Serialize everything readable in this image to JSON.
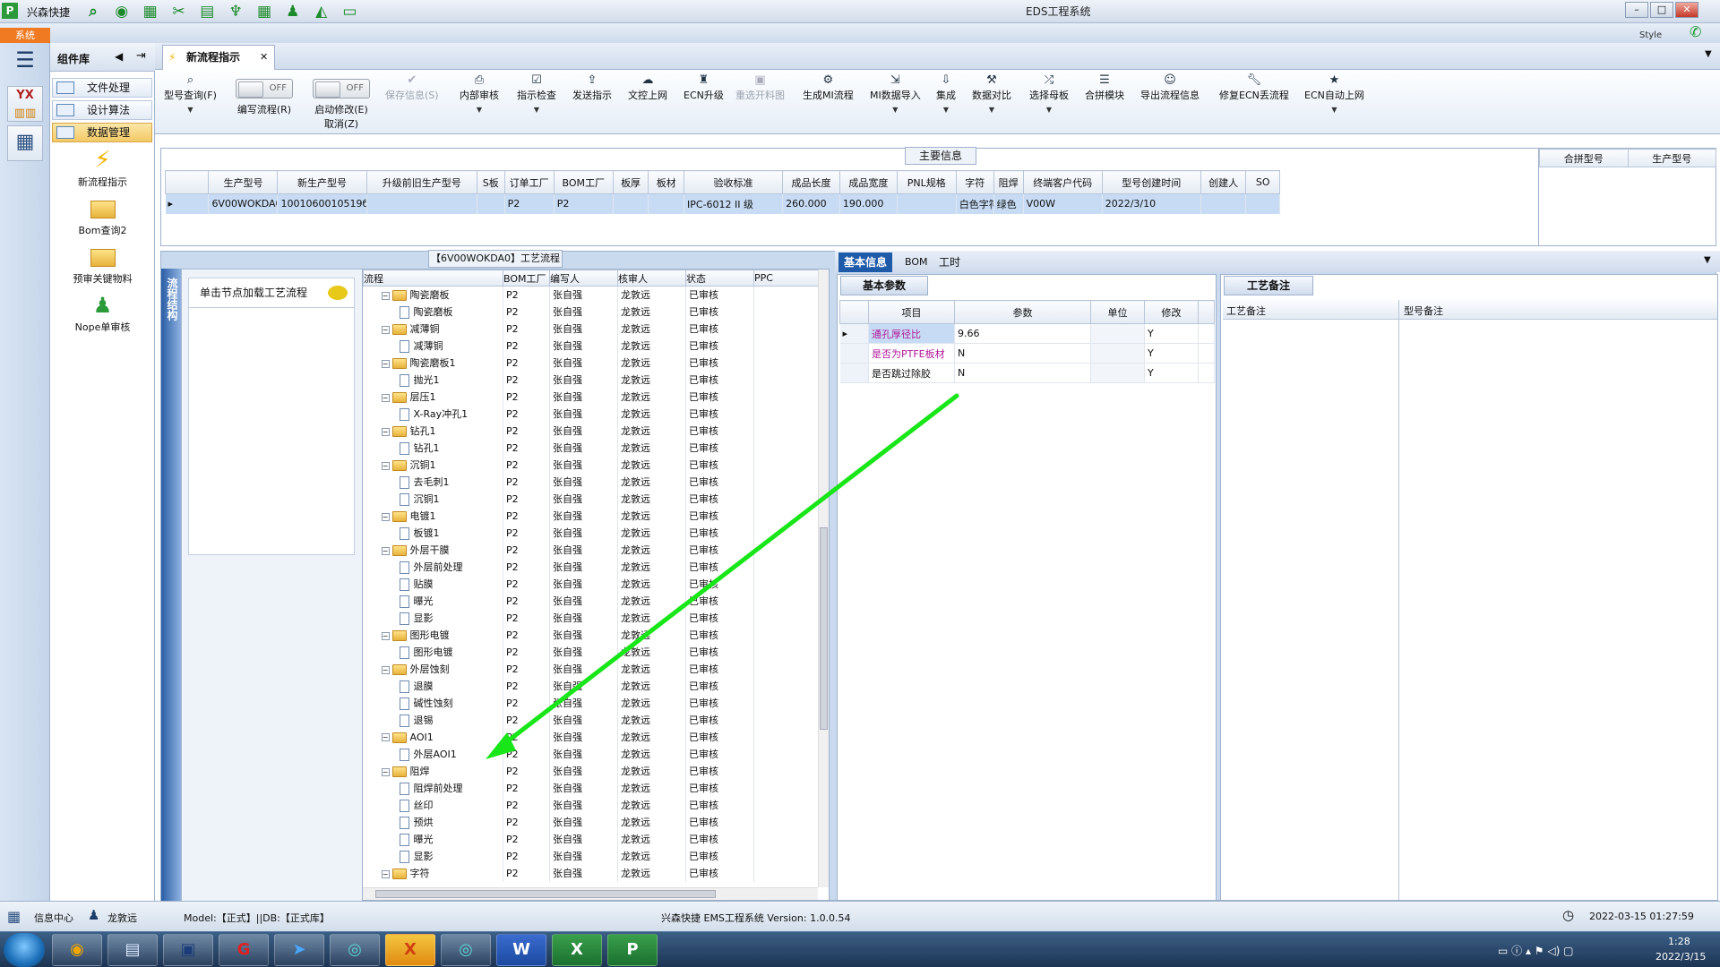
{
  "app": {
    "quick_title": "兴森快捷",
    "window_title": "EDS工程系统",
    "style_label": "Style",
    "sys_tab": "系统"
  },
  "library": {
    "title": "组件库",
    "items": [
      "文件处理",
      "设计算法",
      "数据管理"
    ],
    "tools": [
      "新流程指示",
      "Bom查询2",
      "预审关键物料",
      "Nope单审核"
    ]
  },
  "doc_tab": "新流程指示",
  "toolbar": {
    "items": [
      {
        "label": "型号查询(F)",
        "icon": "search-icon"
      },
      {
        "label": "编写流程(R)",
        "toggle": "OFF"
      },
      {
        "label": "启动修改(E)",
        "label2": "取消(Z)",
        "toggle": "OFF"
      },
      {
        "label": "保存信息(S)",
        "disabled": true
      },
      {
        "label": "内部审核",
        "icon": "print-icon"
      },
      {
        "label": "指示检查",
        "icon": "check-icon"
      },
      {
        "label": "发送指示",
        "icon": "upload-icon"
      },
      {
        "label": "文控上网",
        "icon": "cloud-icon"
      },
      {
        "label": "ECN升级",
        "icon": "ecn-icon"
      },
      {
        "label": "重选开料图",
        "disabled": true
      },
      {
        "label": "生成MI流程",
        "icon": "gears-icon"
      },
      {
        "label": "MI数据导入",
        "icon": "import-icon"
      },
      {
        "label": "集成",
        "icon": "download-icon"
      },
      {
        "label": "数据对比",
        "icon": "compare-icon"
      },
      {
        "label": "选择母板",
        "icon": "shuffle-icon"
      },
      {
        "label": "合拼模块",
        "icon": "list-icon"
      },
      {
        "label": "导出流程信息",
        "icon": "smile-icon"
      },
      {
        "label": "修复ECN丢流程",
        "icon": "wrench-icon"
      },
      {
        "label": "ECN自动上网",
        "icon": "star-icon"
      }
    ]
  },
  "main_info": {
    "title": "主要信息",
    "columns": [
      "生产型号",
      "新生产型号",
      "升级前旧生产型号",
      "S板",
      "订单工厂",
      "BOM工厂",
      "板厚",
      "板材",
      "验收标准",
      "成品长度",
      "成品宽度",
      "PNL规格",
      "字符",
      "阻焊",
      "终端客户代码",
      "型号创建时间",
      "创建人",
      "SO"
    ],
    "row": [
      "6V00WOKDA0",
      "1001060010519б",
      "",
      "",
      "P2",
      "P2",
      "",
      "",
      "IPC-6012 II 级",
      "260.000",
      "190.000",
      "",
      "白色字符",
      "绿色",
      "V00W",
      "2022/3/10",
      "",
      ""
    ],
    "side_columns": [
      "合拼型号",
      "生产型号"
    ]
  },
  "flow": {
    "side_label": "流程结构",
    "hint": "单击节点加载工艺流程"
  },
  "process": {
    "title": "【6V00WOKDA0】工艺流程",
    "columns": [
      "流程",
      "BOM工厂",
      "编写人",
      "核审人",
      "状态",
      "PPC"
    ],
    "rows": [
      {
        "name": "陶瓷磨板",
        "lv": 0
      },
      {
        "name": "陶瓷磨板",
        "lv": 1
      },
      {
        "name": "减薄铜",
        "lv": 0
      },
      {
        "name": "减薄铜",
        "lv": 1
      },
      {
        "name": "陶瓷磨板1",
        "lv": 0
      },
      {
        "name": "抛光1",
        "lv": 1
      },
      {
        "name": "层压1",
        "lv": 0
      },
      {
        "name": "X-Ray冲孔1",
        "lv": 1
      },
      {
        "name": "钻孔1",
        "lv": 0
      },
      {
        "name": "钻孔1",
        "lv": 1
      },
      {
        "name": "沉铜1",
        "lv": 0
      },
      {
        "name": "去毛刺1",
        "lv": 1
      },
      {
        "name": "沉铜1",
        "lv": 1
      },
      {
        "name": "电镀1",
        "lv": 0
      },
      {
        "name": "板镀1",
        "lv": 1
      },
      {
        "name": "外层干膜",
        "lv": 0
      },
      {
        "name": "外层前处理",
        "lv": 1
      },
      {
        "name": "贴膜",
        "lv": 1
      },
      {
        "name": "曝光",
        "lv": 1
      },
      {
        "name": "显影",
        "lv": 1
      },
      {
        "name": "图形电镀",
        "lv": 0
      },
      {
        "name": "图形电镀",
        "lv": 1
      },
      {
        "name": "外层蚀刻",
        "lv": 0
      },
      {
        "name": "退膜",
        "lv": 1
      },
      {
        "name": "碱性蚀刻",
        "lv": 1
      },
      {
        "name": "退锡",
        "lv": 1
      },
      {
        "name": "AOI1",
        "lv": 0
      },
      {
        "name": "外层AOI1",
        "lv": 1
      },
      {
        "name": "阻焊",
        "lv": 0
      },
      {
        "name": "阻焊前处理",
        "lv": 1
      },
      {
        "name": "丝印",
        "lv": 1
      },
      {
        "name": "预烘",
        "lv": 1
      },
      {
        "name": "曝光",
        "lv": 1
      },
      {
        "name": "显影",
        "lv": 1
      },
      {
        "name": "字符",
        "lv": 0
      }
    ],
    "bom": "P2",
    "writer": "张自强",
    "reviewer": "龙敦远",
    "status": "已审核"
  },
  "info_tabs": [
    "基本信息",
    "BOM",
    "工时"
  ],
  "basic": {
    "tab": "基本参数",
    "columns": [
      "项目",
      "参数",
      "单位",
      "修改"
    ],
    "rows": [
      {
        "item": "通孔厚径比",
        "value": "9.66",
        "unit": "",
        "mod": "Y"
      },
      {
        "item": "是否为PTFE板材",
        "value": "N",
        "unit": "",
        "mod": "Y"
      },
      {
        "item": "是否跳过除胶",
        "value": "N",
        "unit": "",
        "mod": "Y"
      }
    ]
  },
  "notes": {
    "tab": "工艺备注",
    "col1": "工艺备注",
    "col2": "型号备注"
  },
  "status": {
    "info_center": "信息中心",
    "user": "龙敦远",
    "model": "Model:【正式】||DB:【正式库】",
    "version": "兴森快捷 EMS工程系统 Version: 1.0.0.54",
    "datetime": "2022-03-15 01:27:59"
  },
  "taskbar": {
    "time": "1:28",
    "date": "2022/3/15"
  },
  "colors": {
    "accent": "#1f5aa8",
    "highlight": "#c7dcf4",
    "arrow": "#19e619",
    "magenta": "#b0169a"
  }
}
